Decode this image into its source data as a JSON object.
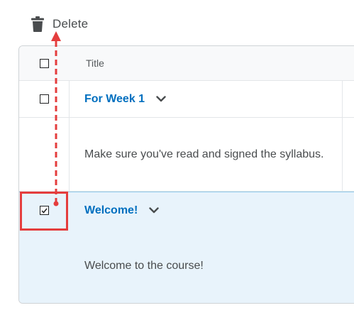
{
  "toolbar": {
    "delete_label": "Delete",
    "delete_icon": "trash-icon"
  },
  "table": {
    "header": {
      "title_label": "Title",
      "select_all_checked": false
    },
    "items": [
      {
        "title": "For Week 1",
        "description": "Make sure you've read and signed the syllabus.",
        "checked": false
      },
      {
        "title": "Welcome!",
        "description": "Welcome to the course!",
        "checked": true
      }
    ]
  },
  "colors": {
    "link": "#006fbf",
    "selected_row_bg": "#e8f3fb",
    "annotation": "#e43d3d"
  }
}
